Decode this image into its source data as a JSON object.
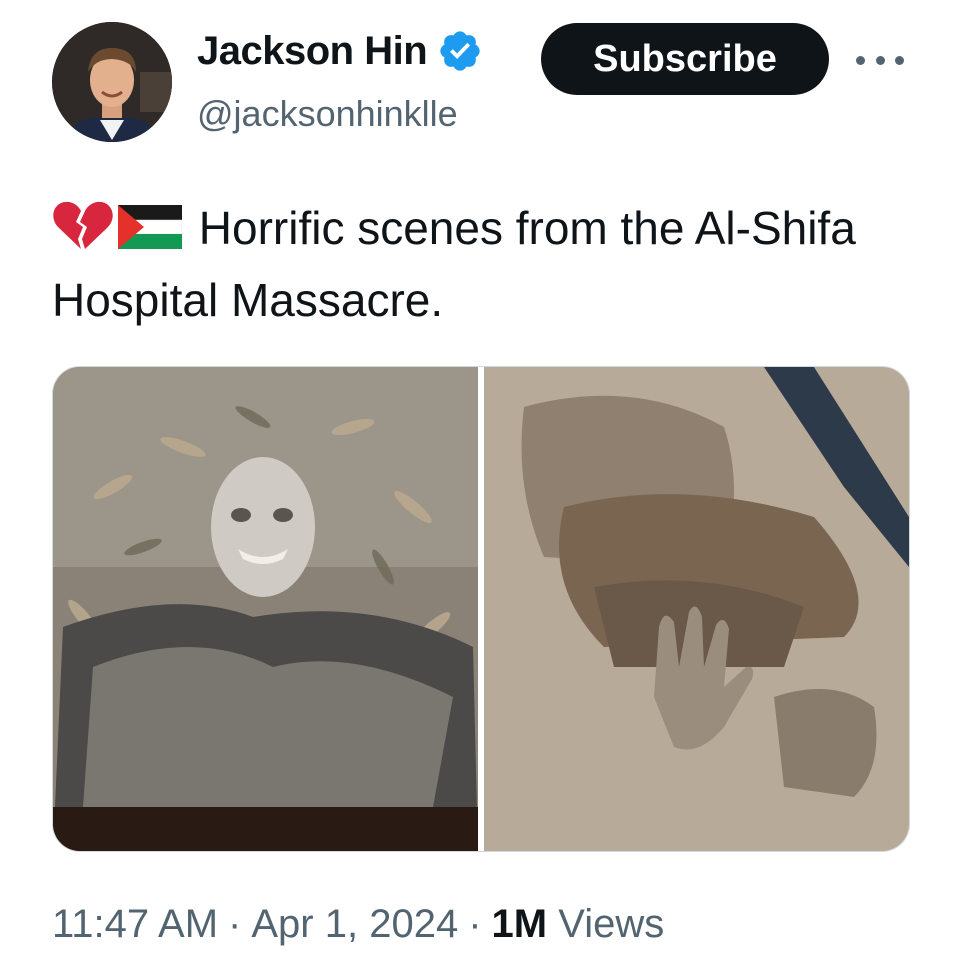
{
  "author": {
    "name": "Jackson Hin",
    "handle": "@jacksonhinklle",
    "verified": true,
    "avatar_icon": "profile-photo"
  },
  "actions": {
    "subscribe_label": "Subscribe",
    "more_icon": "more-horizontal-icon"
  },
  "tweet": {
    "emojis": [
      "broken-heart-emoji",
      "palestine-flag-emoji"
    ],
    "text": "Horrific scenes from the Al-Shifa Hospital Massacre."
  },
  "media": {
    "count": 2
  },
  "meta": {
    "time": "11:47 AM",
    "date": "Apr 1, 2024",
    "views_count": "1M",
    "views_label": "Views"
  },
  "colors": {
    "text": "#0f1419",
    "secondary": "#536471",
    "verified": "#1d9bf0",
    "button_bg": "#0f1419"
  }
}
